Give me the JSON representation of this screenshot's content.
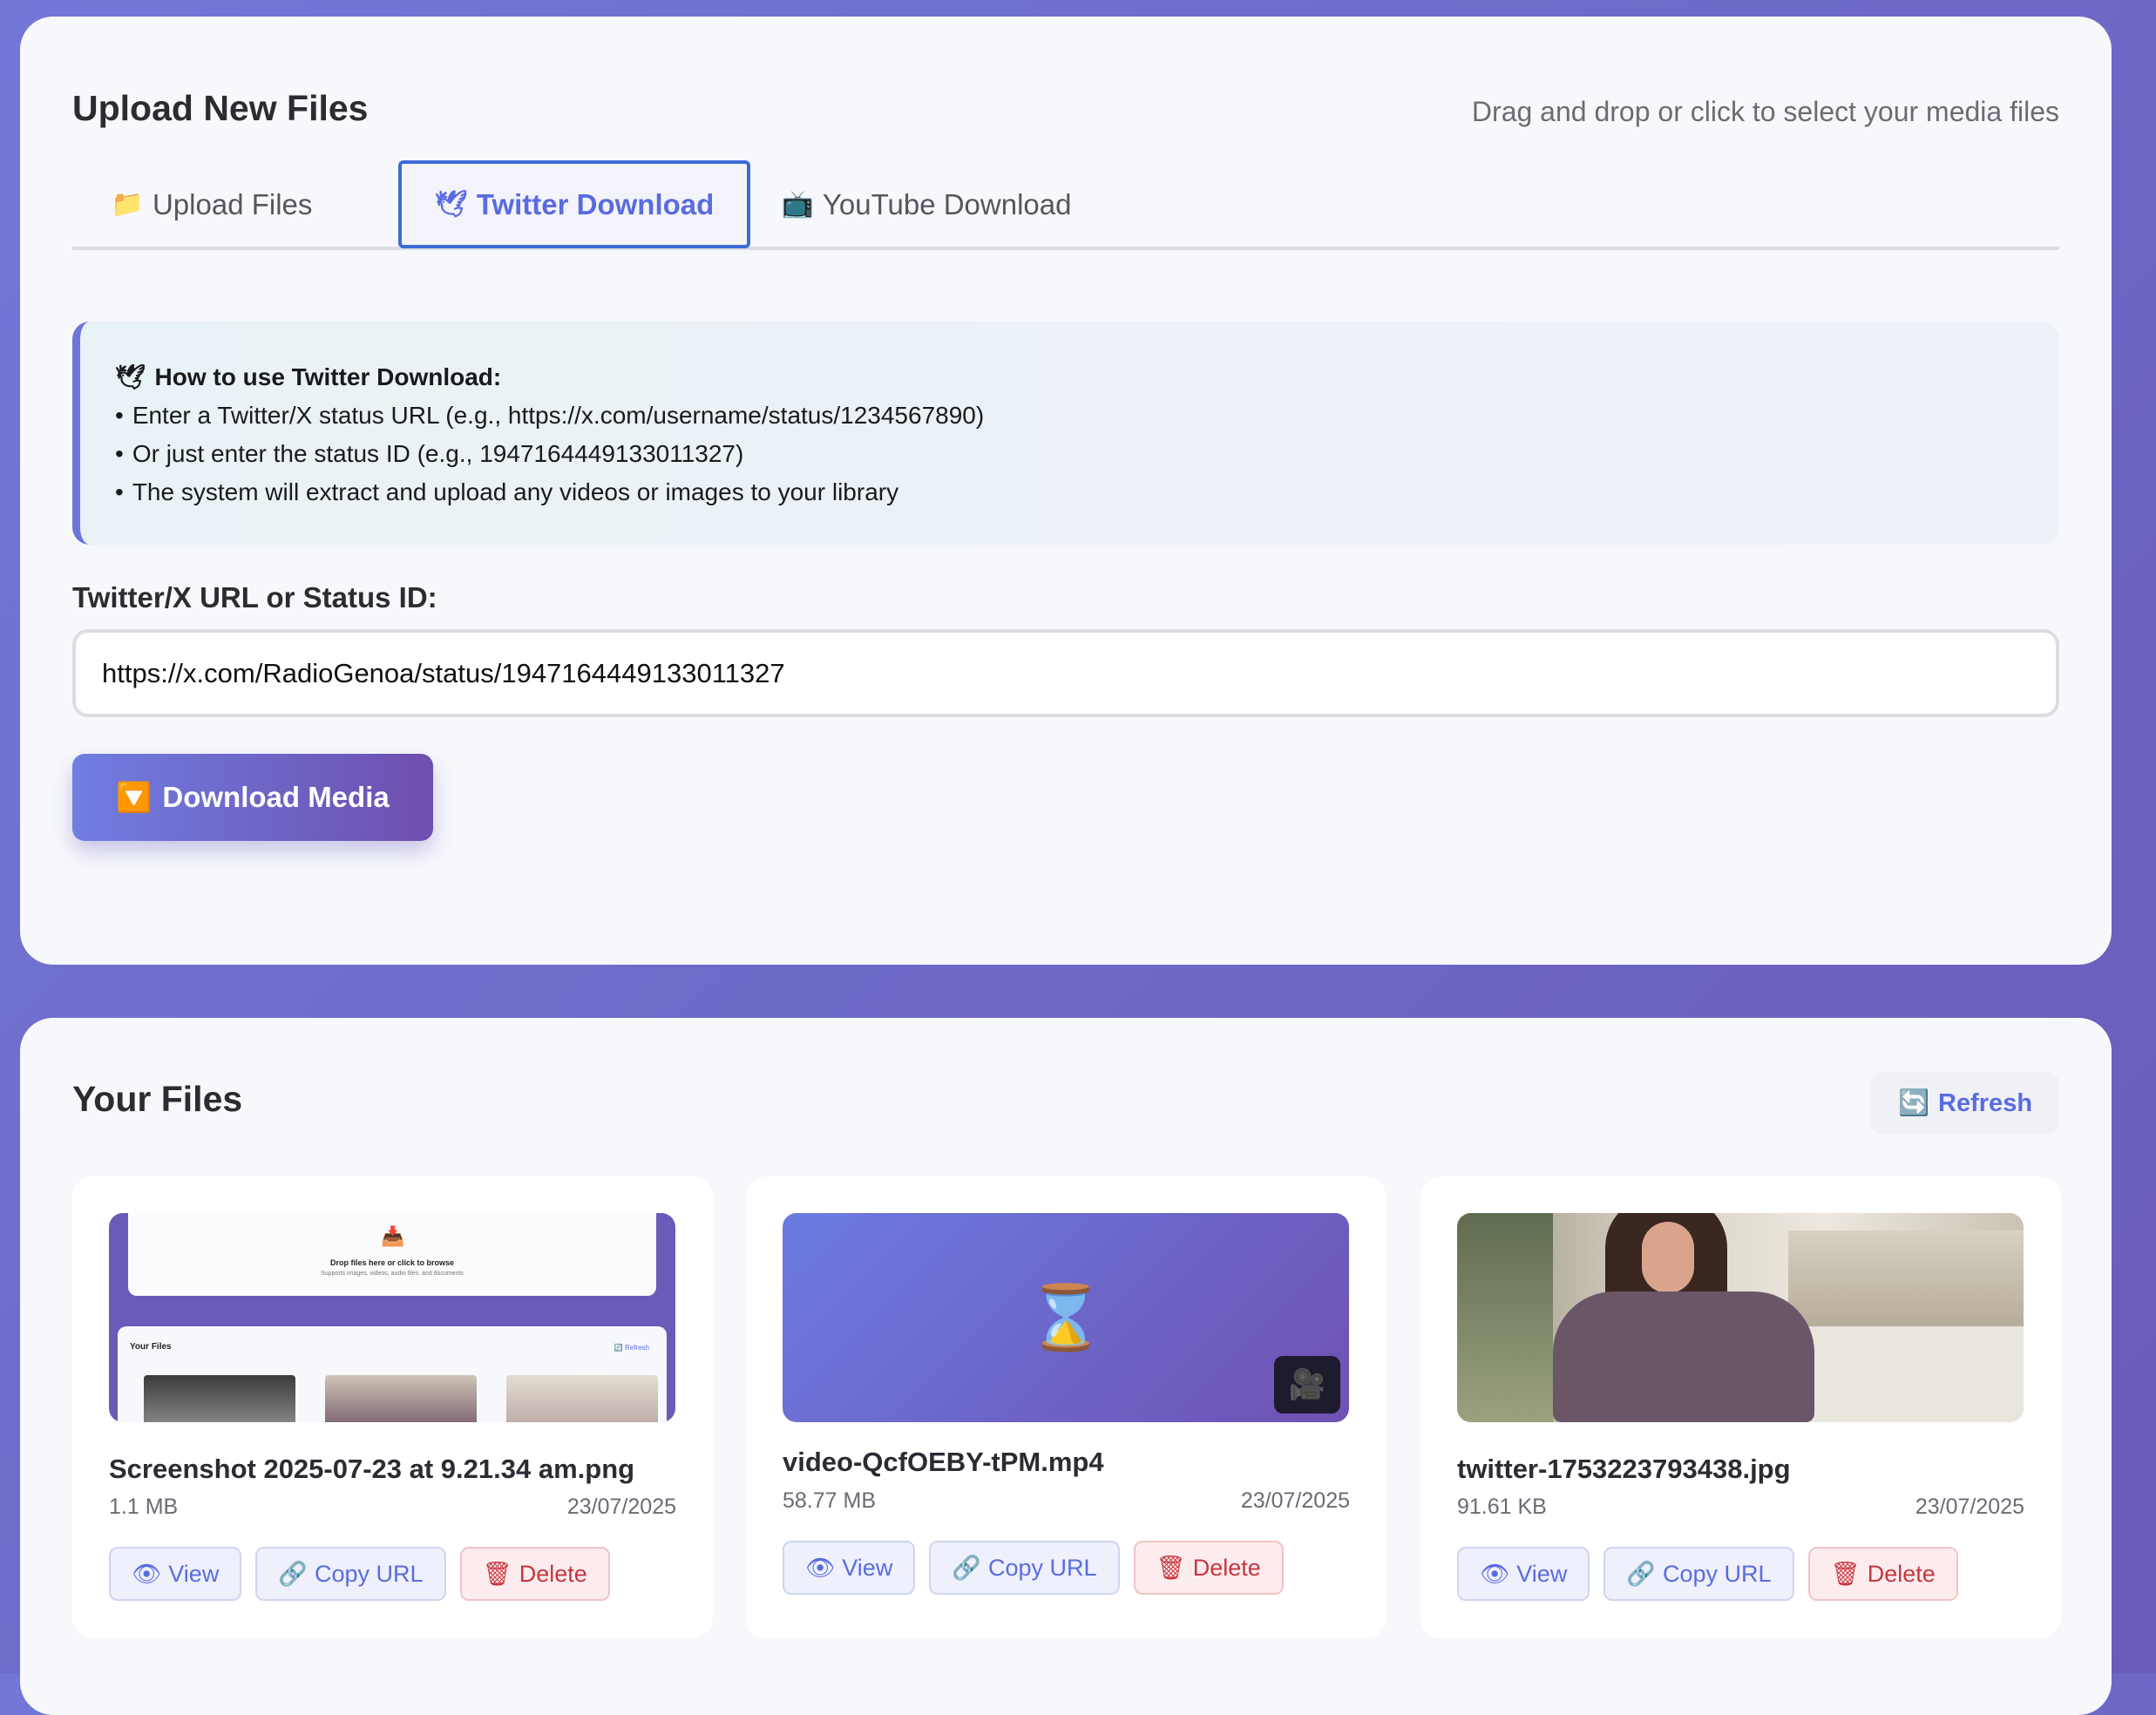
{
  "upload": {
    "title": "Upload New Files",
    "subtitle": "Drag and drop or click to select your media files",
    "tabs": [
      {
        "icon": "📁",
        "label": "Upload Files"
      },
      {
        "icon": "🕊",
        "label": "Twitter Download"
      },
      {
        "icon": "📺",
        "label": "YouTube Download"
      }
    ],
    "active_tab": "Twitter Download",
    "howto": {
      "icon": "🕊",
      "heading": "How to use Twitter Download:",
      "lines": [
        "Enter a Twitter/X status URL (e.g., https://x.com/username/status/1234567890)",
        "Or just enter the status ID (e.g., 1947164449133011327)",
        "The system will extract and upload any videos or images to your library"
      ],
      "bullet": "•"
    },
    "url_label": "Twitter/X URL or Status ID:",
    "url_value": "https://x.com/RadioGenoa/status/1947164449133011327",
    "download_icon": "🔽",
    "download_label": "Download Media"
  },
  "files": {
    "title": "Your Files",
    "refresh_icon": "🔄",
    "refresh_label": "Refresh",
    "items": [
      {
        "name": "Screenshot 2025-07-23 at 9.21.34 am.png",
        "size": "1.1 MB",
        "date": "23/07/2025",
        "thumb": {
          "tray_icon": "📥",
          "drop_text": "Drop files here or click to browse",
          "drop_sub": "Supports images, videos, audio files, and documents",
          "files_title": "Your Files",
          "refresh_text": "🔄 Refresh"
        }
      },
      {
        "name": "video-QcfOEBY-tPM.mp4",
        "size": "58.77 MB",
        "date": "23/07/2025",
        "thumb": {
          "loading_icon": "⌛",
          "camera_icon": "🎥"
        }
      },
      {
        "name": "twitter-1753223793438.jpg",
        "size": "91.61 KB",
        "date": "23/07/2025"
      }
    ],
    "actions": {
      "view_icon": "👁",
      "view_label": "View",
      "copy_icon": "🔗",
      "copy_label": "Copy URL",
      "delete_icon": "🗑",
      "delete_label": "Delete"
    }
  }
}
